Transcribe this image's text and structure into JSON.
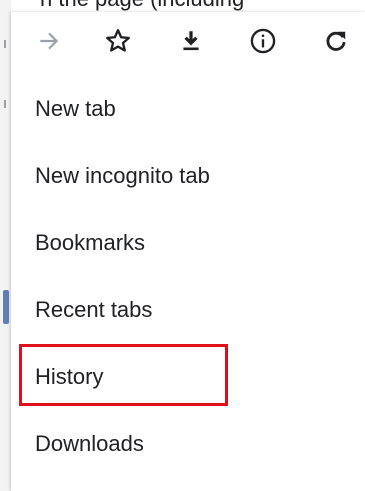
{
  "background": {
    "partial_text": "n the page (including"
  },
  "toolbar": {
    "forward_icon": "arrow-right-icon",
    "bookmark_icon": "star-outline-icon",
    "download_icon": "download-icon",
    "info_icon": "info-icon",
    "reload_icon": "reload-icon"
  },
  "menu": {
    "items": [
      {
        "label": "New tab"
      },
      {
        "label": "New incognito tab"
      },
      {
        "label": "Bookmarks"
      },
      {
        "label": "Recent tabs"
      },
      {
        "label": "History"
      },
      {
        "label": "Downloads"
      }
    ]
  },
  "colors": {
    "highlight": "#e0101a",
    "icon": "#202124",
    "disabled_icon": "#9aa0a6",
    "text": "#202124"
  }
}
